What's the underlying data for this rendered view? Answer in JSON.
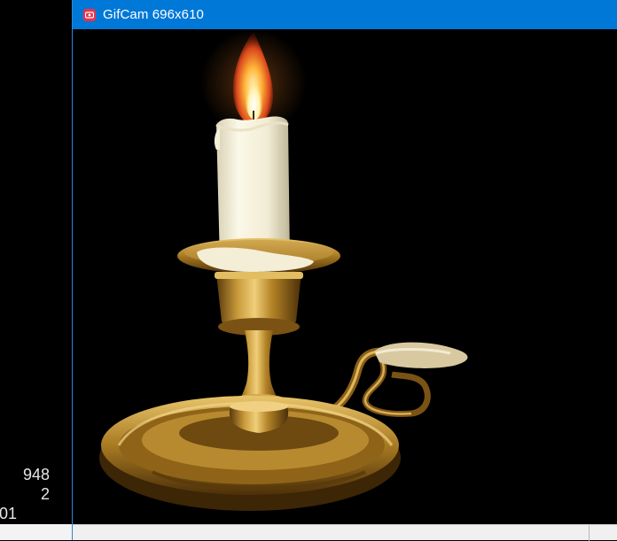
{
  "window": {
    "title": "GifCam 696x610",
    "icon": "gifcam-icon",
    "accent": "#0078d7",
    "icon_color": "#e8334a"
  },
  "left_pane": {
    "numbers": [
      "948",
      "2",
      "01"
    ]
  },
  "capture": {
    "subject": "lit candle in brass candlestick holder on black background"
  }
}
